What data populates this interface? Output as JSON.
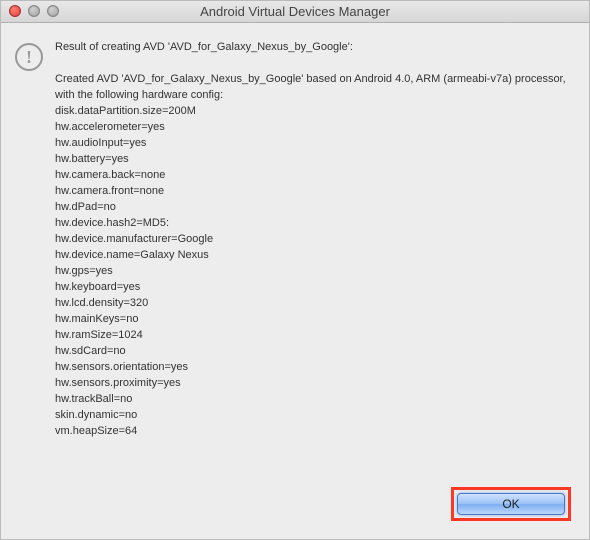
{
  "window": {
    "title": "Android Virtual Devices Manager"
  },
  "message": {
    "header": "Result of creating AVD 'AVD_for_Galaxy_Nexus_by_Google':",
    "created": "Created AVD 'AVD_for_Galaxy_Nexus_by_Google' based on Android 4.0, ARM (armeabi-v7a) processor,",
    "configIntro": "with the following hardware config:",
    "config": [
      "disk.dataPartition.size=200M",
      "hw.accelerometer=yes",
      "hw.audioInput=yes",
      "hw.battery=yes",
      "hw.camera.back=none",
      "hw.camera.front=none",
      "hw.dPad=no",
      "hw.device.hash2=MD5:",
      "hw.device.manufacturer=Google",
      "hw.device.name=Galaxy Nexus",
      "hw.gps=yes",
      "hw.keyboard=yes",
      "hw.lcd.density=320",
      "hw.mainKeys=no",
      "hw.ramSize=1024",
      "hw.sdCard=no",
      "hw.sensors.orientation=yes",
      "hw.sensors.proximity=yes",
      "hw.trackBall=no",
      "skin.dynamic=no",
      "vm.heapSize=64"
    ]
  },
  "buttons": {
    "ok": "OK"
  }
}
